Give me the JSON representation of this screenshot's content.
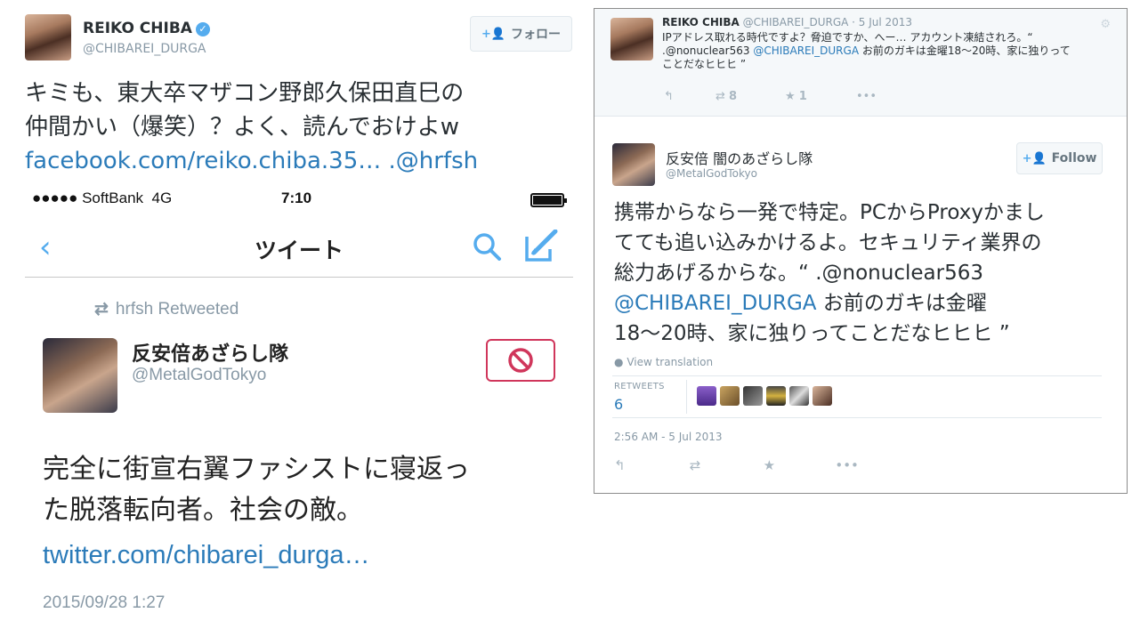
{
  "left_tweet": {
    "name": "REIKO CHIBA",
    "verified_mark": "✓",
    "handle": "@CHIBAREI_DURGA",
    "follow_label": "フォロー",
    "follow_icon": "+👤",
    "text_line1": "キミも、東大卒マザコン野郎久保田直巳の",
    "text_line2": "仲間かい（爆笑）？よく、読んでおけよw",
    "link_text": "facebook.com/reiko.chiba.35…",
    "mention_text": " .@hrfsh"
  },
  "phone": {
    "carrier": "●●●●● SoftBank",
    "network": "4G",
    "time": "7:10",
    "back_icon": "‹",
    "nav_title": "ツイート",
    "retweeted_by": "hrfsh Retweeted",
    "retweet_icon": "⇄",
    "user_name": "反安倍あざらし隊",
    "user_handle": "@MetalGodTokyo",
    "text_line1": "完全に街宣右翼ファシストに寝返っ",
    "text_line2": "た脱落転向者。社会の敵。",
    "link": "twitter.com/chibarei_durga…",
    "date": "2015/09/28 1:27"
  },
  "quoted_tweet": {
    "name": "REIKO CHIBA",
    "handle": " @CHIBAREI_DURGA",
    "date": " · 5 Jul 2013",
    "line1": "IPアドレス取れる時代ですよ？脅迫ですか、へー… アカウント凍結されろ。“",
    "mention1": ".@nonuclear563",
    "mention2": "@CHIBAREI_DURGA",
    "line2_rest": " お前のガキは金曜18〜20時、家に独りって",
    "line3": "ことだなヒヒヒ ”",
    "retweets": "8",
    "favorites": "1"
  },
  "right_tweet": {
    "name": "反安倍 闇のあざらし隊",
    "handle": "@MetalGodTokyo",
    "follow_label": "Follow",
    "text1": "携帯からなら一発で特定。PCからProxyかまし",
    "text2": "てても追い込みかけるよ。セキュリティ業界の",
    "text3": "総力あげるからな。“ .@nonuclear563",
    "mention": "@CHIBAREI_DURGA",
    "text4": " お前のガキは金曜",
    "text5": "18〜20時、家に独りってことだなヒヒヒ ”",
    "view_translation": "View translation",
    "retweets_label": "RETWEETS",
    "retweets_count": "6",
    "timestamp": "2:56 AM - 5 Jul 2013"
  },
  "icons": {
    "reply": "↰",
    "retweet": "⇄",
    "favorite": "★",
    "more": "•••",
    "globe": "●",
    "gear": "⚙"
  },
  "colors": {
    "link": "#2b7bb9",
    "accent": "#55acee",
    "block": "#d0365b",
    "muted": "#8899a6"
  }
}
